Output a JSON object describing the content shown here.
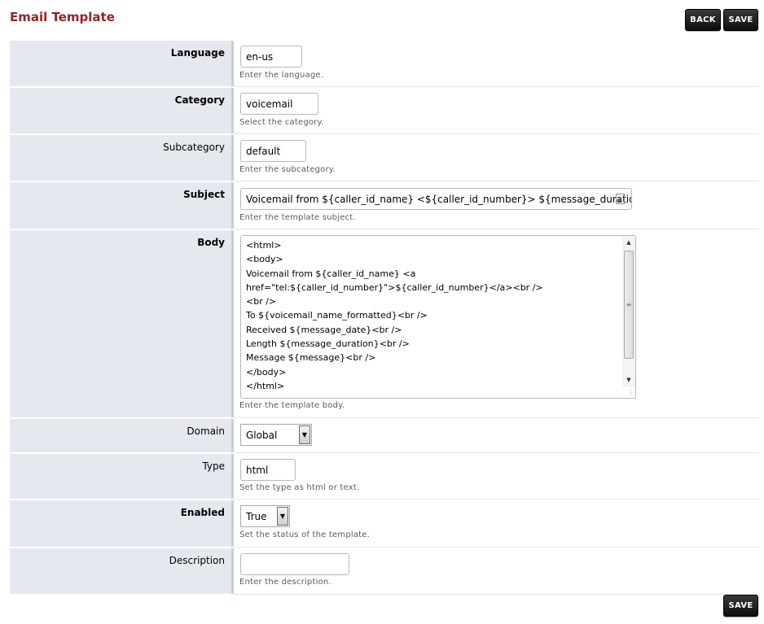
{
  "page": {
    "title": "Email Template"
  },
  "actions": {
    "back_label": "BACK",
    "save_label": "SAVE"
  },
  "fields": {
    "language": {
      "label": "Language",
      "value": "en-us",
      "description": "Enter the language."
    },
    "category": {
      "label": "Category",
      "value": "voicemail",
      "description": "Select the category."
    },
    "subcategory": {
      "label": "Subcategory",
      "value": "default",
      "description": "Enter the subcategory."
    },
    "subject": {
      "label": "Subject",
      "value": "Voicemail from ${caller_id_name} <${caller_id_number}> ${message_duration}",
      "description": "Enter the template subject."
    },
    "body": {
      "label": "Body",
      "lines": [
        "<html>",
        "<body>",
        "Voicemail from ${caller_id_name} <a",
        "href=\"tel:${caller_id_number}\">${caller_id_number}</a><br />",
        "<br />",
        "To ${voicemail_name_formatted}<br />",
        "Received ${message_date}<br />",
        "Length ${message_duration}<br />",
        "Message ${message}<br />",
        "</body>",
        "</html>"
      ],
      "description": "Enter the template body."
    },
    "domain": {
      "label": "Domain",
      "value": "Global"
    },
    "type": {
      "label": "Type",
      "value": "html",
      "description": "Set the type as html or text."
    },
    "enabled": {
      "label": "Enabled",
      "value": "True",
      "description": "Set the status of the template."
    },
    "description": {
      "label": "Description",
      "value": "",
      "description": "Enter the description."
    }
  },
  "icons": {
    "select_arrow": "triangle-down-icon",
    "scroll_up": "triangle-up-icon",
    "scroll_down": "triangle-down-icon",
    "subject_widget": "text-expand-icon"
  },
  "colors": {
    "title": "#952424",
    "label_bg": "#e5e9ef",
    "button_bg": "#1a1a1a"
  }
}
